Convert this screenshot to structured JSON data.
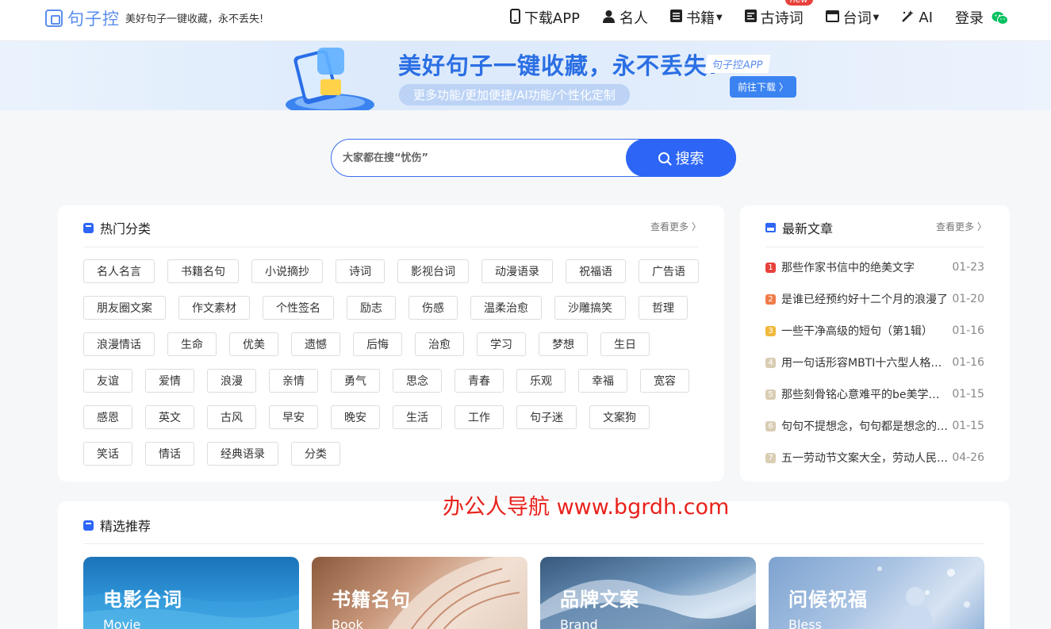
{
  "header": {
    "logo_text": "句子控",
    "slogan": "美好句子一键收藏，永不丢失!",
    "nav": [
      {
        "label": "下载APP",
        "icon": "phone-icon"
      },
      {
        "label": "名人",
        "icon": "user-icon"
      },
      {
        "label": "书籍",
        "icon": "book-icon",
        "dropdown": true
      },
      {
        "label": "古诗词",
        "icon": "poem-icon",
        "badge": "new"
      },
      {
        "label": "台词",
        "icon": "film-icon",
        "dropdown": true
      },
      {
        "label": "AI",
        "icon": "magic-wand-icon"
      }
    ],
    "login_label": "登录",
    "wechat_icon": "wechat-icon"
  },
  "banner": {
    "title": "美好句子一键收藏，永不丢失!",
    "subtitle": "更多功能/更加便捷/AI功能/个性化定制",
    "app_label": "句子控APP",
    "button_label": "前往下载 〉"
  },
  "search": {
    "placeholder": "大家都在搜“忧伤”",
    "button_label": "搜索"
  },
  "hot_categories": {
    "title": "热门分类",
    "more_label": "查看更多 〉",
    "rows": [
      [
        "名人名言",
        "书籍名句",
        "小说摘抄",
        "诗词",
        "影视台词",
        "动漫语录",
        "祝福语",
        "广告语"
      ],
      [
        "朋友圈文案",
        "作文素材",
        "个性签名",
        "励志",
        "伤感",
        "温柔治愈",
        "沙雕搞笑",
        "哲理"
      ],
      [
        "浪漫情话",
        "生命",
        "优美",
        "遗憾",
        "后悔",
        "治愈",
        "学习",
        "梦想",
        "生日"
      ],
      [
        "友谊",
        "爱情",
        "浪漫",
        "亲情",
        "勇气",
        "思念",
        "青春",
        "乐观",
        "幸福",
        "宽容"
      ],
      [
        "感恩",
        "英文",
        "古风",
        "早安",
        "晚安",
        "生活",
        "工作",
        "句子迷",
        "文案狗"
      ],
      [
        "笑话",
        "情话",
        "经典语录",
        "分类"
      ]
    ]
  },
  "latest_articles": {
    "title": "最新文章",
    "more_label": "查看更多 〉",
    "items": [
      {
        "rank": "1",
        "title": "那些作家书信中的绝美文字",
        "date": "01-23",
        "color": "#e8413c"
      },
      {
        "rank": "2",
        "title": "是谁已经预约好十二个月的浪漫了",
        "date": "01-20",
        "color": "#f07b47"
      },
      {
        "rank": "3",
        "title": "一些干净高级的短句（第1辑）",
        "date": "01-16",
        "color": "#f2b83d"
      },
      {
        "rank": "4",
        "title": "用一句话形容MBTI十六型人格的特点",
        "date": "01-16",
        "color": "#d9cdb4"
      },
      {
        "rank": "5",
        "title": "那些刻骨铭心意难平的be美学句子",
        "date": "01-15",
        "color": "#d9cdb4"
      },
      {
        "rank": "6",
        "title": "句句不提想念，句句都是想念的句子",
        "date": "01-15",
        "color": "#d9cdb4"
      },
      {
        "rank": "7",
        "title": "五一劳动节文案大全，劳动人民最光荣",
        "date": "04-26",
        "color": "#d9cdb4"
      }
    ]
  },
  "featured": {
    "title": "精选推荐",
    "cards": [
      {
        "title": "电影台词",
        "en": "Movie"
      },
      {
        "title": "书籍名句",
        "en": "Book"
      },
      {
        "title": "品牌文案",
        "en": "Brand"
      },
      {
        "title": "问候祝福",
        "en": "Bless"
      }
    ]
  },
  "watermark": "办公人导航 www.bgrdh.com",
  "colors": {
    "brand": "#2d66f6",
    "accent_red": "#e8413c"
  }
}
